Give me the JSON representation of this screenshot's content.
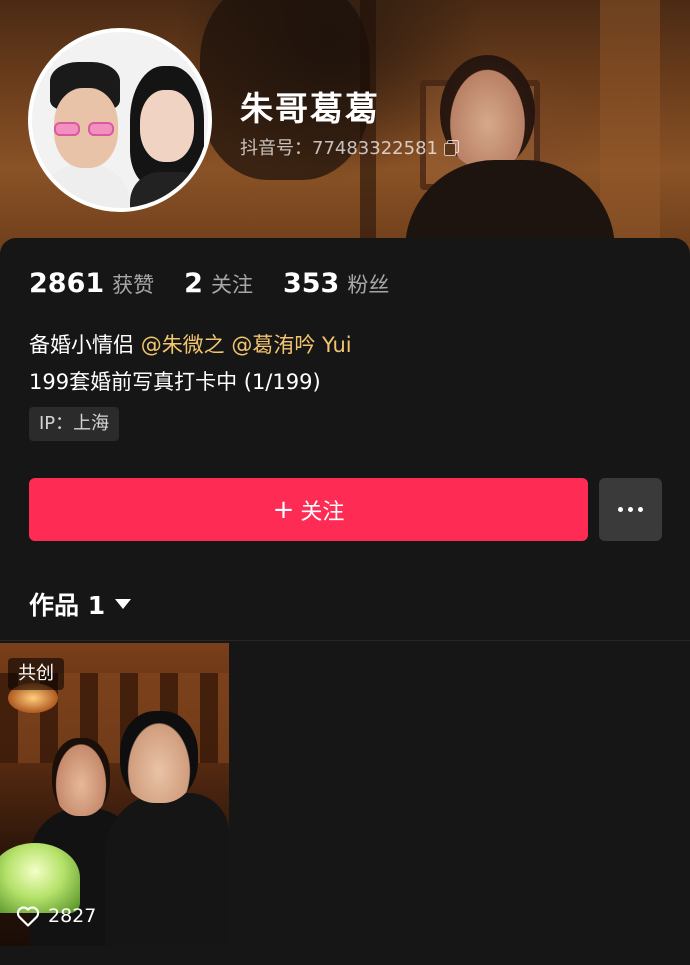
{
  "profile": {
    "nickname": "朱哥葛葛",
    "account_id": "抖音号：77483322581"
  },
  "stats": [
    {
      "value": "2861",
      "label": "获赞"
    },
    {
      "value": "2",
      "label": "关注"
    },
    {
      "value": "353",
      "label": "粉丝"
    }
  ],
  "bio": {
    "line1_prefix": "备婚小情侣 ",
    "mention1": "@朱微之",
    "mention2": "@葛洧吟 Yui",
    "line2": "199套婚前写真打卡中 (1/199)"
  },
  "ip_tag": "IP：上海",
  "actions": {
    "follow_plus": "+",
    "follow_label": "关注"
  },
  "works": {
    "tab_label": "作品 1",
    "items": [
      {
        "badge": "共创",
        "likes": "2827"
      }
    ]
  },
  "colors": {
    "follow_button": "#fe2c55",
    "mention": "#f2c56e",
    "background": "#161616"
  },
  "icons": [
    "copy-icon",
    "plus-icon",
    "more-icon",
    "caret-down-icon",
    "heart-icon"
  ]
}
